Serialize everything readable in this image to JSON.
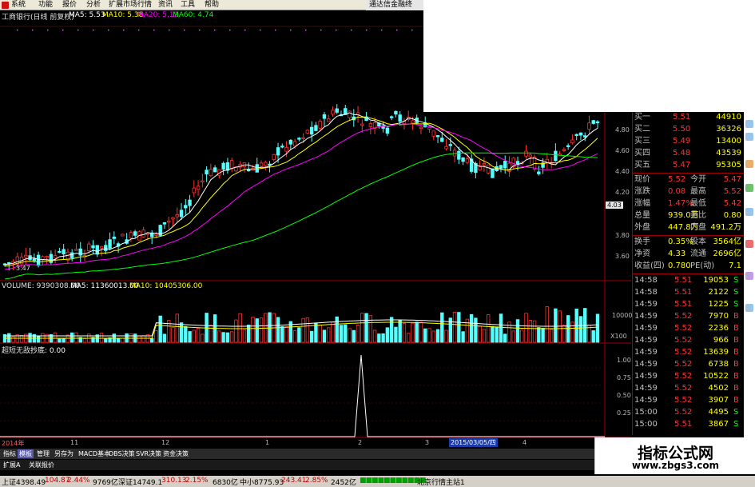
{
  "menu": {
    "items": [
      "系统",
      "功能",
      "报价",
      "分析",
      "扩展市场行情",
      "资讯",
      "工具",
      "帮助"
    ],
    "brand": "通达信金融终"
  },
  "chart": {
    "title": "工商银行(日线 前复权)",
    "ma_legend": [
      {
        "label": "MA5: 5.53",
        "color": "#ffffff"
      },
      {
        "label": "MA10: 5.38",
        "color": "#ffff00"
      },
      {
        "label": "MA20: 5.12",
        "color": "#ff00ff"
      },
      {
        "label": "MA60: 4.74",
        "color": "#00ff00"
      }
    ],
    "price_ticks": [
      "4.80",
      "4.60",
      "4.40",
      "4.20",
      "3.80",
      "3.60"
    ],
    "current_price_tag": "4.03",
    "min_label": "3.47",
    "volume_legend": {
      "vol": "VOLUME: 9390308.00",
      "ma5": "MA5: 11360013.00",
      "ma10": "MA10: 10405306.00"
    },
    "volume_ticks": [
      "10000"
    ],
    "volume_unit": "X100",
    "indicator_legend": {
      "name": "超短无敌",
      "value": "抄底: 0.00"
    },
    "indicator_ticks": [
      "1.00",
      "0.75",
      "0.50",
      "0.25"
    ],
    "date_axis": [
      "2014年",
      "11",
      "12",
      "1",
      "2",
      "3",
      "2015/03/05/四",
      "4"
    ]
  },
  "quote": {
    "orders": [
      {
        "label": "买一",
        "price": "5.51",
        "vol": "44910"
      },
      {
        "label": "买二",
        "price": "5.50",
        "vol": "36326"
      },
      {
        "label": "买三",
        "price": "5.49",
        "vol": "13400"
      },
      {
        "label": "买四",
        "price": "5.48",
        "vol": "43539"
      },
      {
        "label": "买五",
        "price": "5.47",
        "vol": "95305"
      }
    ],
    "stats": [
      {
        "l1": "现价",
        "v1": "5.52",
        "l2": "今开",
        "v2": "5.47"
      },
      {
        "l1": "涨跌",
        "v1": "0.08",
        "l2": "最高",
        "v2": "5.52"
      },
      {
        "l1": "涨幅",
        "v1": "1.47%",
        "l2": "最低",
        "v2": "5.42"
      },
      {
        "l1": "总量",
        "v1": "939.0万",
        "l2": "量比",
        "v2": "0.80"
      },
      {
        "l1": "外盘",
        "v1": "447.8万",
        "l2": "内盘",
        "v2": "491.2万"
      }
    ],
    "finance": [
      {
        "l1": "换手",
        "v1": "0.35%",
        "l2": "股本",
        "v2": "3564亿"
      },
      {
        "l1": "净资",
        "v1": "4.33",
        "l2": "流通",
        "v2": "2696亿"
      },
      {
        "l1": "收益(四)",
        "v1": "0.780",
        "l2": "PE(动)",
        "v2": "7.1"
      }
    ],
    "ticks": [
      {
        "time": "14:58",
        "price": "5.51",
        "vol": "19053",
        "side": "S"
      },
      {
        "time": "14:58",
        "price": "5.51",
        "vol": "2122",
        "side": "S"
      },
      {
        "time": "14:59",
        "price": "5.51",
        "vol": "1225",
        "side": "S"
      },
      {
        "time": "14:59",
        "price": "5.52",
        "vol": "7970",
        "side": "B"
      },
      {
        "time": "14:59",
        "price": "5.52",
        "vol": "2236",
        "side": "B"
      },
      {
        "time": "14:59",
        "price": "5.52",
        "vol": "966",
        "side": "B"
      },
      {
        "time": "14:59",
        "price": "5.52",
        "vol": "13639",
        "side": "B"
      },
      {
        "time": "14:59",
        "price": "5.52",
        "vol": "6738",
        "side": "B"
      },
      {
        "time": "14:59",
        "price": "5.52",
        "vol": "10522",
        "side": "B"
      },
      {
        "time": "14:59",
        "price": "5.52",
        "vol": "4502",
        "side": "B"
      },
      {
        "time": "14:59",
        "price": "5.52",
        "vol": "3907",
        "side": "B"
      },
      {
        "time": "15:00",
        "price": "5.52",
        "vol": "4495",
        "side": "S"
      },
      {
        "time": "15:00",
        "price": "5.51",
        "vol": "3867",
        "side": "S"
      }
    ]
  },
  "tabs": {
    "row1": [
      "指标",
      "模板",
      "管理",
      "另存为",
      "MACD基本",
      "DBS决策",
      "SVR决策",
      "资金决策"
    ],
    "row2": [
      "扩展A",
      "关联报价"
    ]
  },
  "status": {
    "sh": "上证4398.49",
    "sh_chg": "104.87",
    "sh_pct": "2.44%",
    "sh_amt": "9769亿",
    "sz": "深证14749.1",
    "sz_chg": "310.13",
    "sz_pct": "2.15%",
    "sz_amt": "6830亿",
    "zx": "中小8775.93",
    "zx_chg": "243.41",
    "zx_pct": "2.85%",
    "zx_amt": "2452亿",
    "server": "北京行情主站1"
  },
  "watermark": {
    "title": "指标公式网",
    "url": "www.zbgs3.com"
  },
  "colors": {
    "up": "#ff3232",
    "down": "#54ffff",
    "ma5": "#ffffff",
    "ma10": "#ffff00",
    "ma20": "#ff00ff",
    "ma60": "#00ff00",
    "grid": "#a00000"
  }
}
